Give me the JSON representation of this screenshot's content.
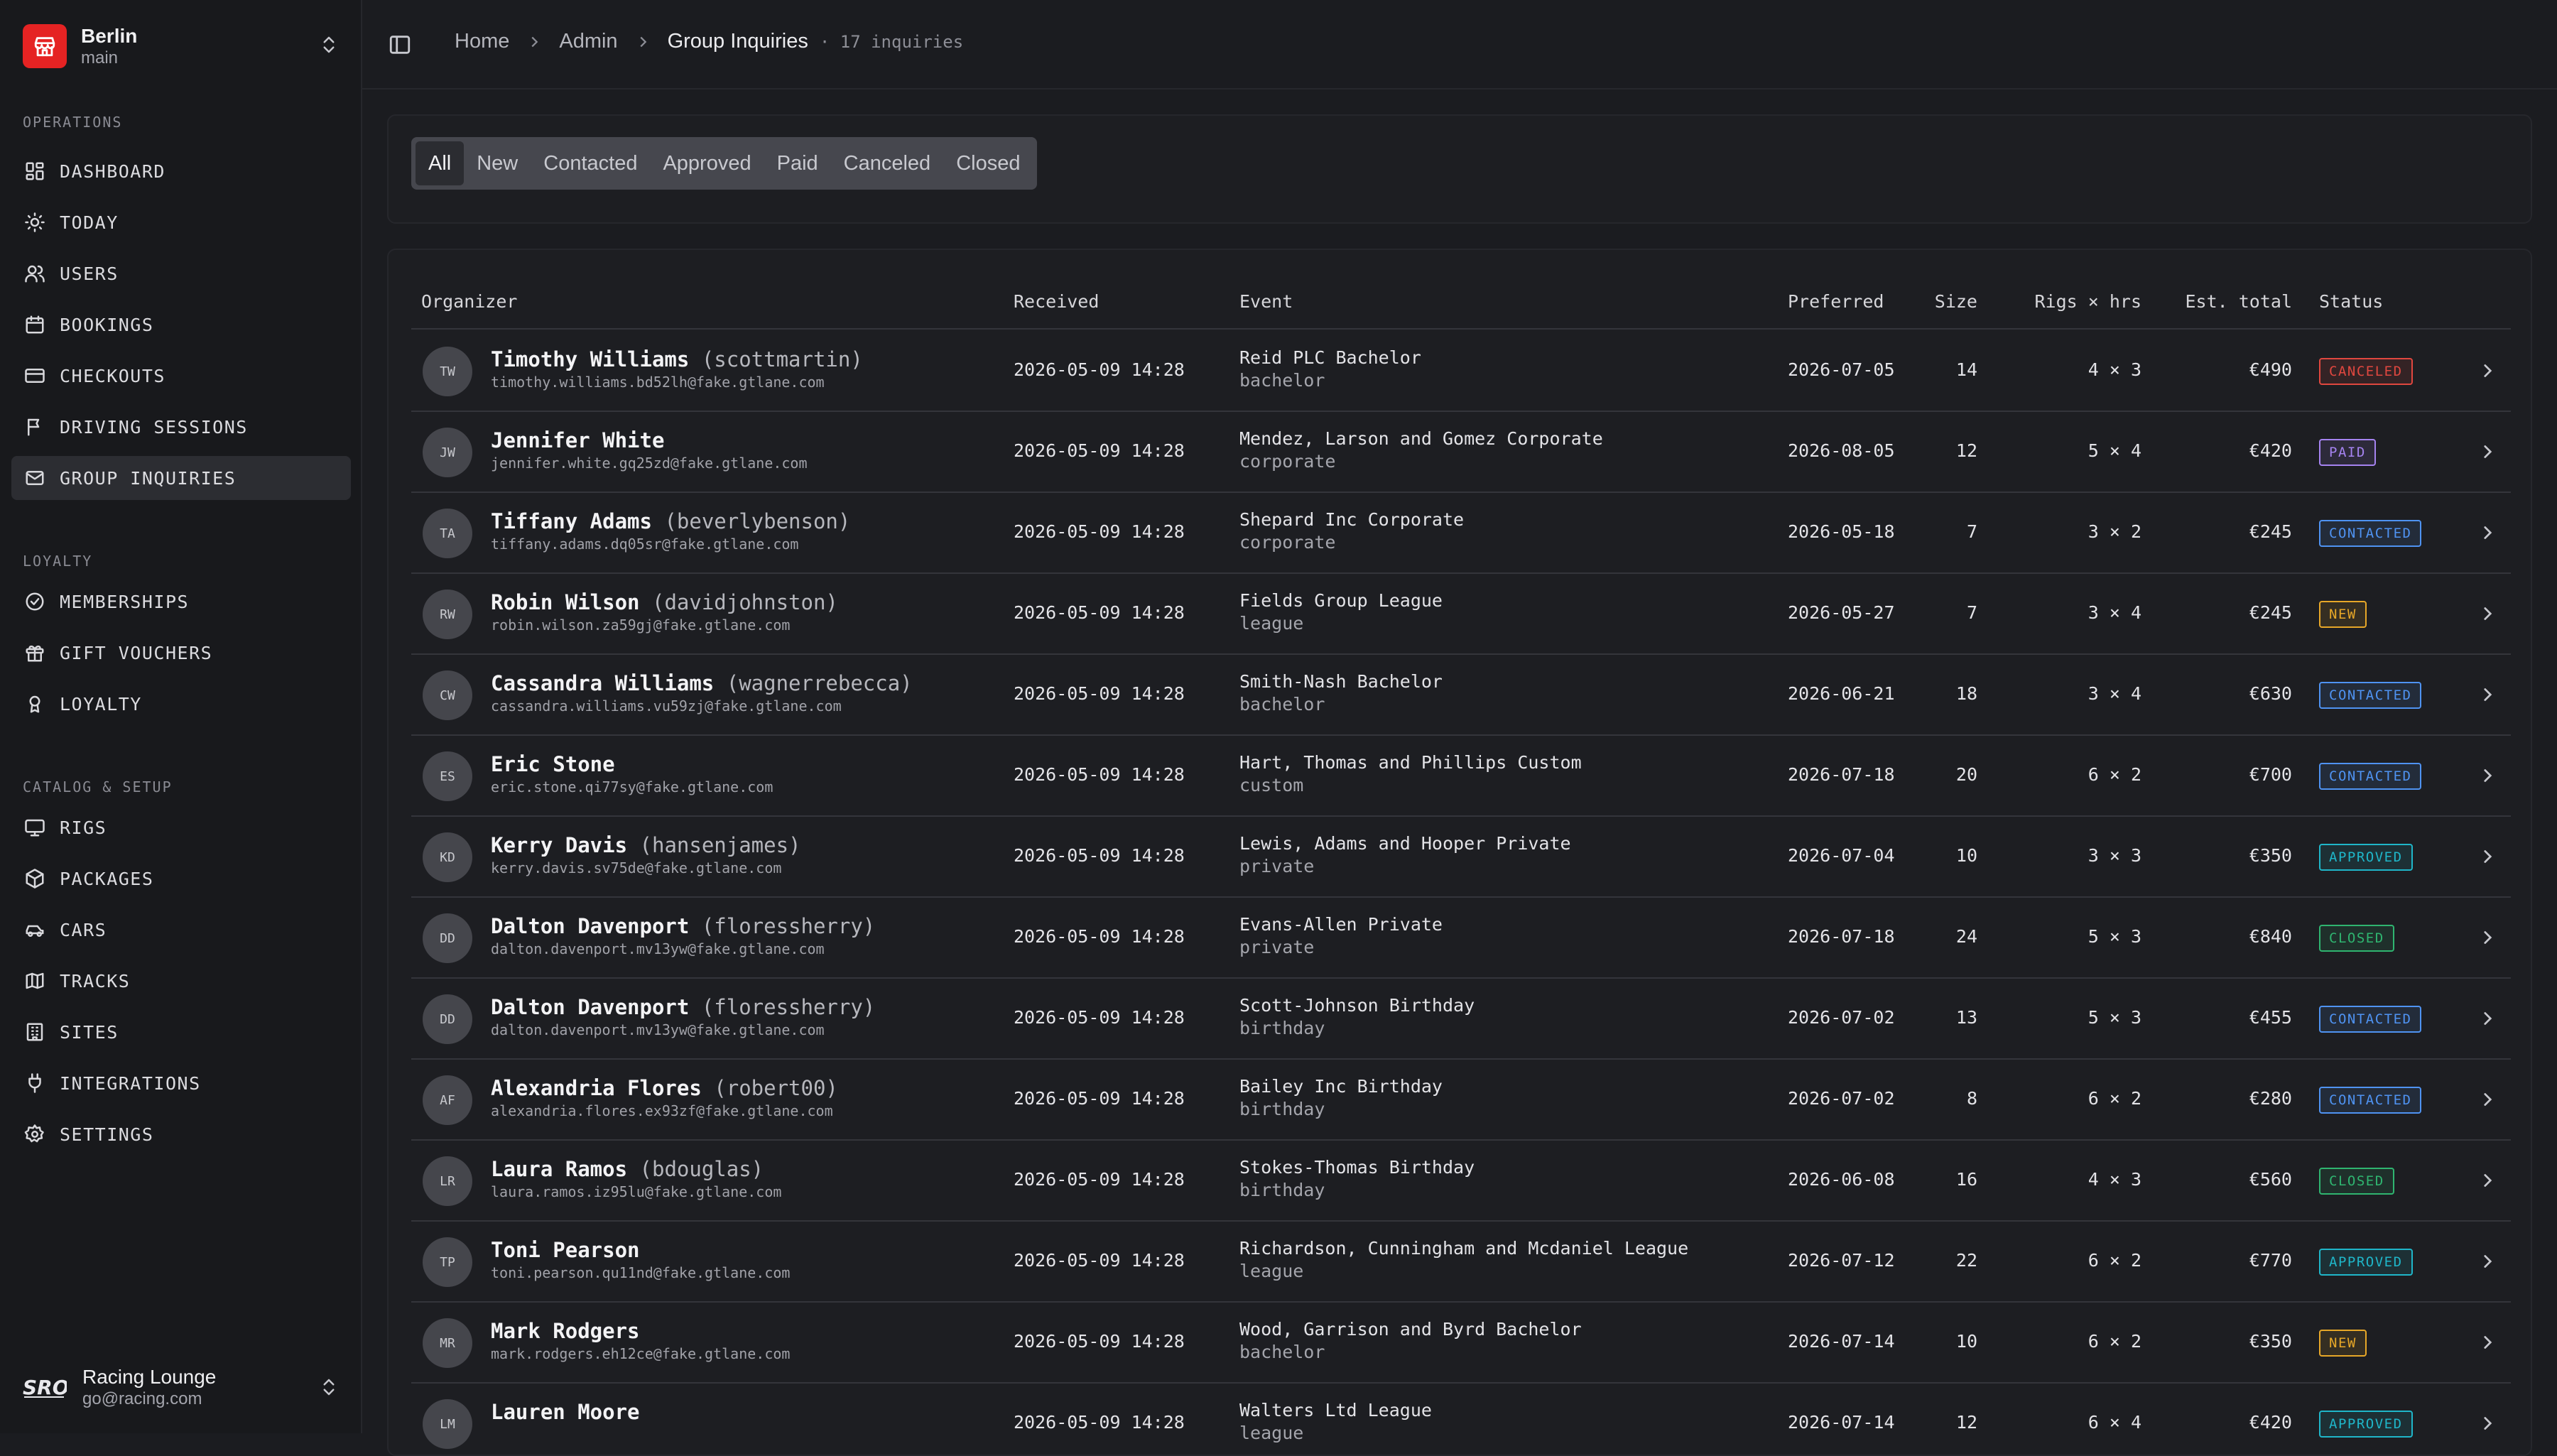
{
  "sidebar": {
    "org": {
      "name": "Berlin",
      "branch": "main"
    },
    "sections": [
      {
        "title": "OPERATIONS",
        "items": [
          {
            "label": "DASHBOARD",
            "icon": "dashboard-icon"
          },
          {
            "label": "TODAY",
            "icon": "sun-icon"
          },
          {
            "label": "USERS",
            "icon": "users-icon"
          },
          {
            "label": "BOOKINGS",
            "icon": "calendar-icon"
          },
          {
            "label": "CHECKOUTS",
            "icon": "credit-card-icon"
          },
          {
            "label": "DRIVING SESSIONS",
            "icon": "flag-icon"
          },
          {
            "label": "GROUP INQUIRIES",
            "icon": "mail-icon"
          }
        ]
      },
      {
        "title": "LOYALTY",
        "items": [
          {
            "label": "MEMBERSHIPS",
            "icon": "check-circle-icon"
          },
          {
            "label": "GIFT VOUCHERS",
            "icon": "gift-icon"
          },
          {
            "label": "LOYALTY",
            "icon": "award-icon"
          }
        ]
      },
      {
        "title": "CATALOG & SETUP",
        "items": [
          {
            "label": "RIGS",
            "icon": "monitor-icon"
          },
          {
            "label": "PACKAGES",
            "icon": "package-icon"
          },
          {
            "label": "CARS",
            "icon": "car-icon"
          },
          {
            "label": "TRACKS",
            "icon": "map-icon"
          },
          {
            "label": "SITES",
            "icon": "building-icon"
          },
          {
            "label": "INTEGRATIONS",
            "icon": "plug-icon"
          },
          {
            "label": "SETTINGS",
            "icon": "gear-icon"
          }
        ]
      }
    ],
    "active": "GROUP INQUIRIES",
    "footer": {
      "name": "Racing Lounge",
      "email": "go@racing.com",
      "logo": "SRO"
    }
  },
  "breadcrumb": {
    "items": [
      "Home",
      "Admin",
      "Group Inquiries"
    ],
    "count": "17 inquiries"
  },
  "filters": {
    "tabs": [
      "All",
      "New",
      "Contacted",
      "Approved",
      "Paid",
      "Canceled",
      "Closed"
    ],
    "active": "All"
  },
  "table": {
    "columns": {
      "organizer": "Organizer",
      "received": "Received",
      "event": "Event",
      "preferred": "Preferred",
      "size": "Size",
      "rigs": "Rigs × hrs",
      "total": "Est. total",
      "status": "Status"
    },
    "rows": [
      {
        "initials": "TW",
        "name": "Timothy Williams",
        "username": "(scottmartin)",
        "email": "timothy.williams.bd52lh@fake.gtlane.com",
        "received": "2026-05-09 14:28",
        "event": "Reid PLC Bachelor",
        "type": "bachelor",
        "preferred": "2026-07-05",
        "size": "14",
        "rigs": "4 × 3",
        "total": "€490",
        "status": "CANCELED"
      },
      {
        "initials": "JW",
        "name": "Jennifer White",
        "username": "",
        "email": "jennifer.white.gq25zd@fake.gtlane.com",
        "received": "2026-05-09 14:28",
        "event": "Mendez, Larson and Gomez Corporate",
        "type": "corporate",
        "preferred": "2026-08-05",
        "size": "12",
        "rigs": "5 × 4",
        "total": "€420",
        "status": "PAID"
      },
      {
        "initials": "TA",
        "name": "Tiffany Adams",
        "username": "(beverlybenson)",
        "email": "tiffany.adams.dq05sr@fake.gtlane.com",
        "received": "2026-05-09 14:28",
        "event": "Shepard Inc Corporate",
        "type": "corporate",
        "preferred": "2026-05-18",
        "size": "7",
        "rigs": "3 × 2",
        "total": "€245",
        "status": "CONTACTED"
      },
      {
        "initials": "RW",
        "name": "Robin Wilson",
        "username": "(davidjohnston)",
        "email": "robin.wilson.za59gj@fake.gtlane.com",
        "received": "2026-05-09 14:28",
        "event": "Fields Group League",
        "type": "league",
        "preferred": "2026-05-27",
        "size": "7",
        "rigs": "3 × 4",
        "total": "€245",
        "status": "NEW"
      },
      {
        "initials": "CW",
        "name": "Cassandra Williams",
        "username": "(wagnerrebecca)",
        "email": "cassandra.williams.vu59zj@fake.gtlane.com",
        "received": "2026-05-09 14:28",
        "event": "Smith-Nash Bachelor",
        "type": "bachelor",
        "preferred": "2026-06-21",
        "size": "18",
        "rigs": "3 × 4",
        "total": "€630",
        "status": "CONTACTED"
      },
      {
        "initials": "ES",
        "name": "Eric Stone",
        "username": "",
        "email": "eric.stone.qi77sy@fake.gtlane.com",
        "received": "2026-05-09 14:28",
        "event": "Hart, Thomas and Phillips Custom",
        "type": "custom",
        "preferred": "2026-07-18",
        "size": "20",
        "rigs": "6 × 2",
        "total": "€700",
        "status": "CONTACTED"
      },
      {
        "initials": "KD",
        "name": "Kerry Davis",
        "username": "(hansenjames)",
        "email": "kerry.davis.sv75de@fake.gtlane.com",
        "received": "2026-05-09 14:28",
        "event": "Lewis, Adams and Hooper Private",
        "type": "private",
        "preferred": "2026-07-04",
        "size": "10",
        "rigs": "3 × 3",
        "total": "€350",
        "status": "APPROVED"
      },
      {
        "initials": "DD",
        "name": "Dalton Davenport",
        "username": "(floressherry)",
        "email": "dalton.davenport.mv13yw@fake.gtlane.com",
        "received": "2026-05-09 14:28",
        "event": "Evans-Allen Private",
        "type": "private",
        "preferred": "2026-07-18",
        "size": "24",
        "rigs": "5 × 3",
        "total": "€840",
        "status": "CLOSED"
      },
      {
        "initials": "DD",
        "name": "Dalton Davenport",
        "username": "(floressherry)",
        "email": "dalton.davenport.mv13yw@fake.gtlane.com",
        "received": "2026-05-09 14:28",
        "event": "Scott-Johnson Birthday",
        "type": "birthday",
        "preferred": "2026-07-02",
        "size": "13",
        "rigs": "5 × 3",
        "total": "€455",
        "status": "CONTACTED"
      },
      {
        "initials": "AF",
        "name": "Alexandria Flores",
        "username": "(robert00)",
        "email": "alexandria.flores.ex93zf@fake.gtlane.com",
        "received": "2026-05-09 14:28",
        "event": "Bailey Inc Birthday",
        "type": "birthday",
        "preferred": "2026-07-02",
        "size": "8",
        "rigs": "6 × 2",
        "total": "€280",
        "status": "CONTACTED"
      },
      {
        "initials": "LR",
        "name": "Laura Ramos",
        "username": "(bdouglas)",
        "email": "laura.ramos.iz95lu@fake.gtlane.com",
        "received": "2026-05-09 14:28",
        "event": "Stokes-Thomas Birthday",
        "type": "birthday",
        "preferred": "2026-06-08",
        "size": "16",
        "rigs": "4 × 3",
        "total": "€560",
        "status": "CLOSED"
      },
      {
        "initials": "TP",
        "name": "Toni Pearson",
        "username": "",
        "email": "toni.pearson.qu11nd@fake.gtlane.com",
        "received": "2026-05-09 14:28",
        "event": "Richardson, Cunningham and Mcdaniel League",
        "type": "league",
        "preferred": "2026-07-12",
        "size": "22",
        "rigs": "6 × 2",
        "total": "€770",
        "status": "APPROVED"
      },
      {
        "initials": "MR",
        "name": "Mark Rodgers",
        "username": "",
        "email": "mark.rodgers.eh12ce@fake.gtlane.com",
        "received": "2026-05-09 14:28",
        "event": "Wood, Garrison and Byrd Bachelor",
        "type": "bachelor",
        "preferred": "2026-07-14",
        "size": "10",
        "rigs": "6 × 2",
        "total": "€350",
        "status": "NEW"
      },
      {
        "initials": "LM",
        "name": "Lauren Moore",
        "username": "",
        "email": "",
        "received": "2026-05-09 14:28",
        "event": "Walters Ltd League",
        "type": "league",
        "preferred": "2026-07-14",
        "size": "12",
        "rigs": "6 × 4",
        "total": "€420",
        "status": "APPROVED"
      }
    ]
  },
  "status_colors": {
    "CANCELED": "#e0473f",
    "PAID": "#a583f0",
    "CONTACTED": "#4f93f2",
    "NEW": "#e7a728",
    "APPROVED": "#1fb6c9",
    "CLOSED": "#2fb570"
  }
}
